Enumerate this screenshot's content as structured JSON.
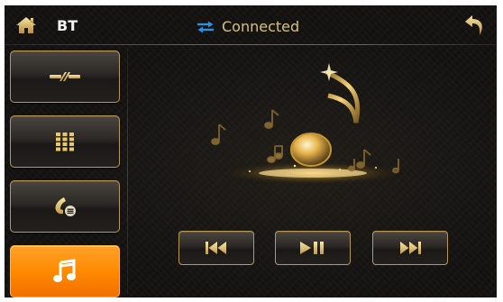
{
  "header": {
    "title": "BT",
    "status": "Connected",
    "icons": {
      "home": "home-icon",
      "status": "swap-arrows-icon",
      "back": "back-arrow-icon"
    }
  },
  "sidebar": {
    "items": [
      {
        "name": "bluetooth-pair",
        "icon": "link-icon",
        "active": false
      },
      {
        "name": "dial-pad",
        "icon": "keypad-icon",
        "active": false
      },
      {
        "name": "call-log",
        "icon": "phone-list-icon",
        "active": false
      },
      {
        "name": "bt-music",
        "icon": "music-note-icon",
        "active": true
      }
    ]
  },
  "player": {
    "controls": [
      {
        "name": "previous",
        "icon": "skip-previous-icon"
      },
      {
        "name": "play-pause",
        "icon": "play-pause-icon"
      },
      {
        "name": "next",
        "icon": "skip-next-icon"
      }
    ]
  },
  "colors": {
    "accent_gold": "#d8c27a",
    "active_orange": "#ff8a00",
    "status_blue": "#2f8fe0",
    "background": "#121110"
  }
}
